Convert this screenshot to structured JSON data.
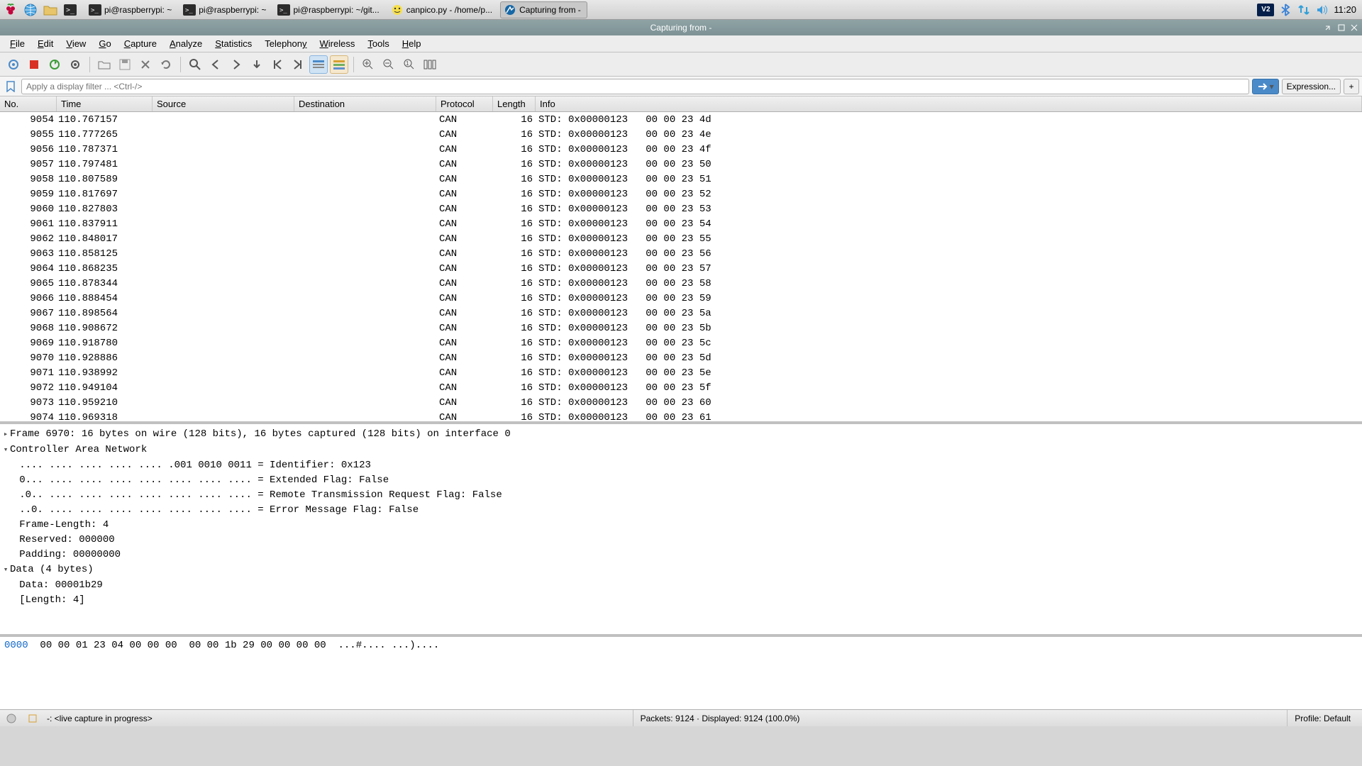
{
  "taskbar": {
    "items": [
      {
        "label": "pi@raspberrypi: ~"
      },
      {
        "label": "pi@raspberrypi: ~"
      },
      {
        "label": "pi@raspberrypi: ~/git..."
      },
      {
        "label": "canpico.py - /home/p..."
      },
      {
        "label": "Capturing from -",
        "active": true
      }
    ],
    "clock": "11:20"
  },
  "window": {
    "title": "Capturing from -"
  },
  "menu": {
    "file": "File",
    "edit": "Edit",
    "view": "View",
    "go": "Go",
    "capture": "Capture",
    "analyze": "Analyze",
    "statistics": "Statistics",
    "telephony": "Telephony",
    "wireless": "Wireless",
    "tools": "Tools",
    "help": "Help"
  },
  "filter": {
    "placeholder": "Apply a display filter ... <Ctrl-/>",
    "expression": "Expression...",
    "plus": "+"
  },
  "columns": {
    "no": "No.",
    "time": "Time",
    "source": "Source",
    "destination": "Destination",
    "protocol": "Protocol",
    "length": "Length",
    "info": "Info"
  },
  "packets": [
    {
      "no": "9054",
      "time": "110.767157",
      "proto": "CAN",
      "len": "16",
      "info": "STD: 0x00000123   00 00 23 4d"
    },
    {
      "no": "9055",
      "time": "110.777265",
      "proto": "CAN",
      "len": "16",
      "info": "STD: 0x00000123   00 00 23 4e"
    },
    {
      "no": "9056",
      "time": "110.787371",
      "proto": "CAN",
      "len": "16",
      "info": "STD: 0x00000123   00 00 23 4f"
    },
    {
      "no": "9057",
      "time": "110.797481",
      "proto": "CAN",
      "len": "16",
      "info": "STD: 0x00000123   00 00 23 50"
    },
    {
      "no": "9058",
      "time": "110.807589",
      "proto": "CAN",
      "len": "16",
      "info": "STD: 0x00000123   00 00 23 51"
    },
    {
      "no": "9059",
      "time": "110.817697",
      "proto": "CAN",
      "len": "16",
      "info": "STD: 0x00000123   00 00 23 52"
    },
    {
      "no": "9060",
      "time": "110.827803",
      "proto": "CAN",
      "len": "16",
      "info": "STD: 0x00000123   00 00 23 53"
    },
    {
      "no": "9061",
      "time": "110.837911",
      "proto": "CAN",
      "len": "16",
      "info": "STD: 0x00000123   00 00 23 54"
    },
    {
      "no": "9062",
      "time": "110.848017",
      "proto": "CAN",
      "len": "16",
      "info": "STD: 0x00000123   00 00 23 55"
    },
    {
      "no": "9063",
      "time": "110.858125",
      "proto": "CAN",
      "len": "16",
      "info": "STD: 0x00000123   00 00 23 56"
    },
    {
      "no": "9064",
      "time": "110.868235",
      "proto": "CAN",
      "len": "16",
      "info": "STD: 0x00000123   00 00 23 57"
    },
    {
      "no": "9065",
      "time": "110.878344",
      "proto": "CAN",
      "len": "16",
      "info": "STD: 0x00000123   00 00 23 58"
    },
    {
      "no": "9066",
      "time": "110.888454",
      "proto": "CAN",
      "len": "16",
      "info": "STD: 0x00000123   00 00 23 59"
    },
    {
      "no": "9067",
      "time": "110.898564",
      "proto": "CAN",
      "len": "16",
      "info": "STD: 0x00000123   00 00 23 5a"
    },
    {
      "no": "9068",
      "time": "110.908672",
      "proto": "CAN",
      "len": "16",
      "info": "STD: 0x00000123   00 00 23 5b"
    },
    {
      "no": "9069",
      "time": "110.918780",
      "proto": "CAN",
      "len": "16",
      "info": "STD: 0x00000123   00 00 23 5c"
    },
    {
      "no": "9070",
      "time": "110.928886",
      "proto": "CAN",
      "len": "16",
      "info": "STD: 0x00000123   00 00 23 5d"
    },
    {
      "no": "9071",
      "time": "110.938992",
      "proto": "CAN",
      "len": "16",
      "info": "STD: 0x00000123   00 00 23 5e"
    },
    {
      "no": "9072",
      "time": "110.949104",
      "proto": "CAN",
      "len": "16",
      "info": "STD: 0x00000123   00 00 23 5f"
    },
    {
      "no": "9073",
      "time": "110.959210",
      "proto": "CAN",
      "len": "16",
      "info": "STD: 0x00000123   00 00 23 60"
    },
    {
      "no": "9074",
      "time": "110.969318",
      "proto": "CAN",
      "len": "16",
      "info": "STD: 0x00000123   00 00 23 61"
    }
  ],
  "detail": {
    "frame": "Frame 6970: 16 bytes on wire (128 bits), 16 bytes captured (128 bits) on interface 0",
    "can": "Controller Area Network",
    "id": "   .... .... .... .... .... .001 0010 0011 = Identifier: 0x123",
    "ext": "   0... .... .... .... .... .... .... .... = Extended Flag: False",
    "rtr": "   .0.. .... .... .... .... .... .... .... = Remote Transmission Request Flag: False",
    "err": "   ..0. .... .... .... .... .... .... .... = Error Message Flag: False",
    "flen": "   Frame-Length: 4",
    "res": "   Reserved: 000000",
    "pad": "   Padding: 00000000",
    "datahdr": "Data (4 bytes)",
    "data": "   Data: 00001b29",
    "len": "   [Length: 4]"
  },
  "bytes": {
    "offset": "0000",
    "hex": "  00 00 01 23 04 00 00 00  00 00 1b 29 00 00 00 00  ",
    "ascii": "...#.... ...)...."
  },
  "status": {
    "left": "-: <live capture in progress>",
    "mid": "Packets: 9124 · Displayed: 9124 (100.0%)",
    "right": "Profile: Default"
  }
}
